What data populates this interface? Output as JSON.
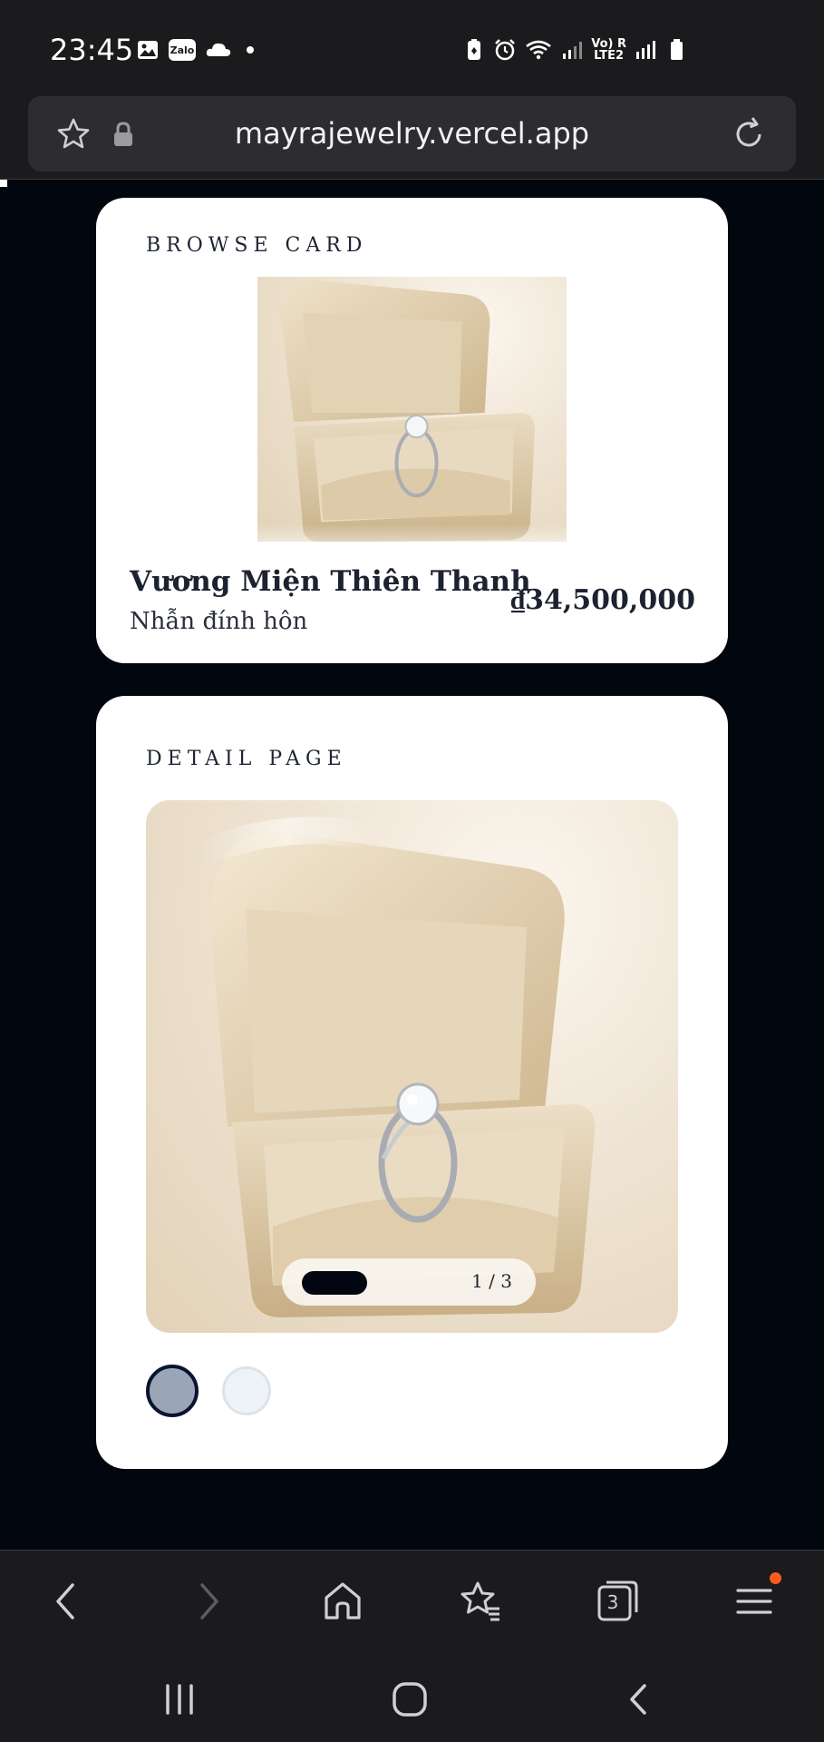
{
  "status_bar": {
    "time": "23:45",
    "left_icons": [
      "image-icon",
      "zalo-icon",
      "cloud-icon",
      "dot-icon"
    ],
    "zalo_label": "Zalo",
    "network_label_top": "Vo) R",
    "network_label_bottom": "LTE2",
    "right_icons": [
      "battery-saver-icon",
      "alarm-icon",
      "wifi-icon",
      "signal-icon",
      "signal-icon-2",
      "battery-icon"
    ]
  },
  "browser": {
    "url": "mayrajewelry.vercel.app",
    "icons": [
      "bookmark-star-icon",
      "lock-icon",
      "reload-icon"
    ]
  },
  "browse_card": {
    "label": "BROWSE CARD",
    "product_name": "Vương Miện Thiên Thanh",
    "product_subtitle": "Nhẫn đính hôn",
    "price": "₫34,500,000"
  },
  "detail_page": {
    "label": "DETAIL PAGE",
    "pager_text": "1 / 3",
    "swatches": [
      "silver",
      "white"
    ],
    "swatch_colors": [
      "#9aa5b5",
      "#eef3f8"
    ]
  },
  "bottom_nav": {
    "tab_count": "3",
    "icons": [
      "back-icon",
      "forward-icon",
      "home-icon",
      "bookmarks-icon",
      "tabs-icon",
      "menu-icon"
    ]
  },
  "system_nav": {
    "icons": [
      "recent-apps-icon",
      "home-circle-icon",
      "system-back-icon"
    ]
  },
  "colors": {
    "page_background": "#02060f",
    "browser_chrome": "#1b1b1d",
    "card": "#ffffff",
    "text_dark": "#1c2230",
    "menu_notification": "#ff5a1f"
  }
}
